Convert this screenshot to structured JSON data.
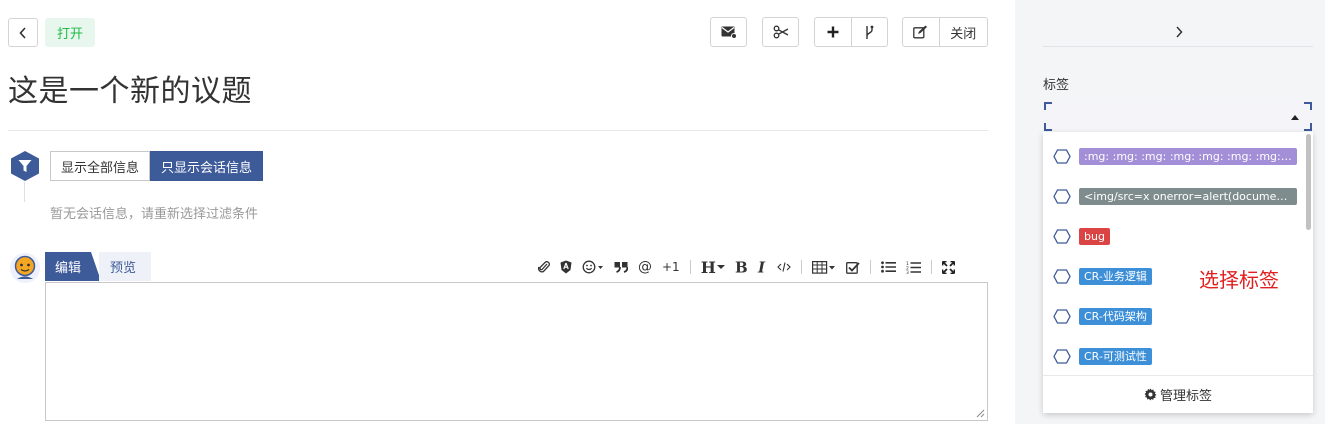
{
  "header": {
    "status": "打开",
    "close_label": "关闭"
  },
  "issue": {
    "title": "这是一个新的议题"
  },
  "timeline": {
    "filter_all_label": "显示全部信息",
    "filter_comments_label": "只显示会话信息",
    "empty_hint": "暂无会话信息，请重新选择过滤条件"
  },
  "editor": {
    "tab_edit": "编辑",
    "tab_preview": "预览",
    "plus_one": "+1",
    "heading_tool": "H"
  },
  "sidebar": {
    "labels_heading": "标签",
    "labels": [
      {
        "text": ":mg: :mg: :mg: :mg: :mg: :mg: :mg: :m…",
        "color": "#a38fd8"
      },
      {
        "text": "<img/src=x onerror=alert(document.…",
        "color": "#7f8c8d"
      },
      {
        "text": "bug",
        "color": "#db4444"
      },
      {
        "text": "CR-业务逻辑",
        "color": "#3d8fd8"
      },
      {
        "text": "CR-代码架构",
        "color": "#3d8fd8"
      },
      {
        "text": "CR-可测试性",
        "color": "#3d8fd8"
      }
    ],
    "manage_label": "管理标签"
  },
  "annotation": {
    "text": "选择标签"
  },
  "colors": {
    "primary": "#3d5a99",
    "open_green": "#21ba45",
    "annotation_red": "#e02020"
  }
}
